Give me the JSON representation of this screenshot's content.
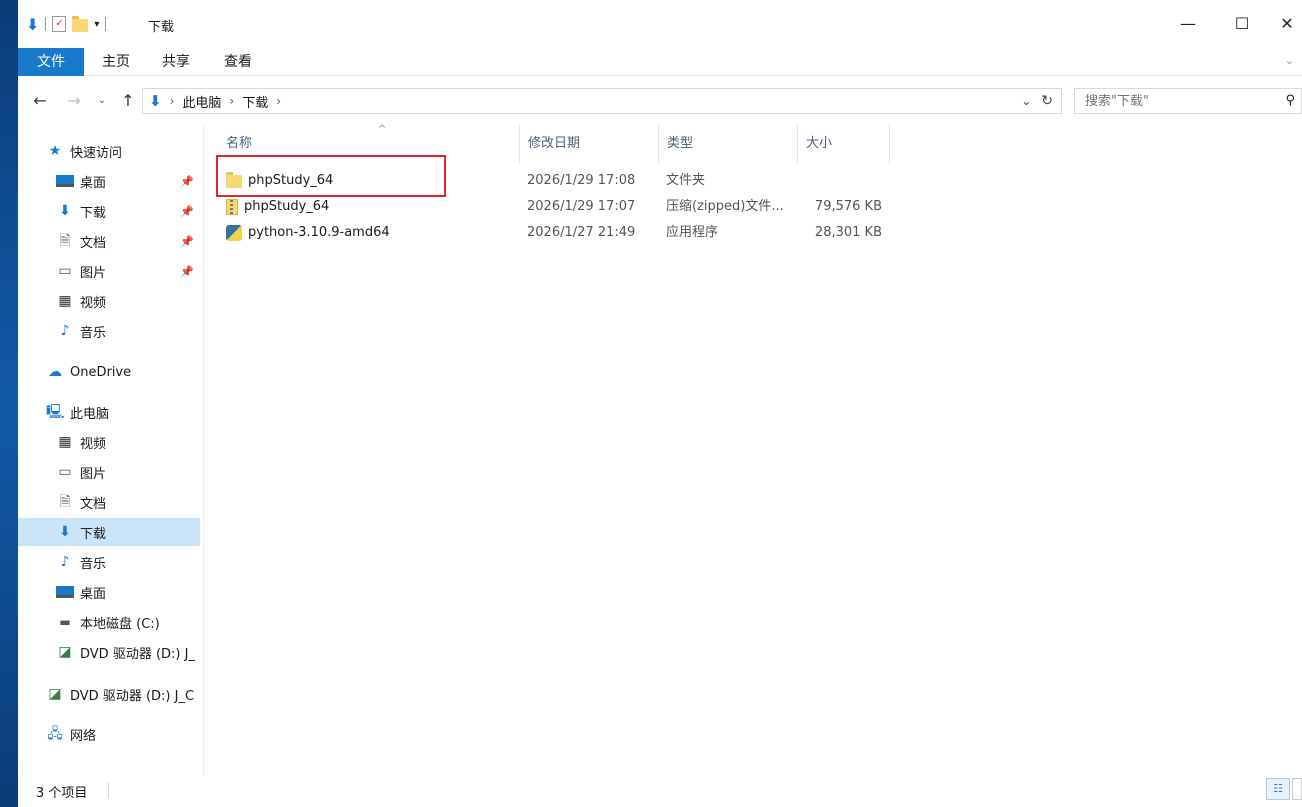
{
  "window": {
    "title": "下载",
    "minimize_icon": "minimize-icon",
    "maximize_icon": "maximize-icon",
    "close_icon": "close-icon"
  },
  "ribbon": {
    "tabs": [
      "文件",
      "主页",
      "共享",
      "查看"
    ]
  },
  "address": {
    "crumbs": [
      "此电脑",
      "下载"
    ],
    "search_placeholder": "搜索\"下载\""
  },
  "navpane": {
    "quick_access": "快速访问",
    "quick_items": [
      "桌面",
      "下载",
      "文档",
      "图片",
      "视频",
      "音乐"
    ],
    "onedrive": "OneDrive",
    "this_pc": "此电脑",
    "pc_items": [
      "视频",
      "图片",
      "文档",
      "下载",
      "音乐",
      "桌面",
      "本地磁盘 (C:)",
      "DVD 驱动器 (D:) J_"
    ],
    "dvd": "DVD 驱动器 (D:) J_C",
    "network": "网络"
  },
  "filelist": {
    "columns": [
      "名称",
      "修改日期",
      "类型",
      "大小"
    ],
    "rows": [
      {
        "name": "phpStudy_64",
        "date": "2026/1/29 17:08",
        "type": "文件夹",
        "size": "",
        "icon": "folder-icon"
      },
      {
        "name": "phpStudy_64",
        "date": "2026/1/29 17:07",
        "type": "压缩(zipped)文件...",
        "size": "79,576 KB",
        "icon": "zip-icon"
      },
      {
        "name": "python-3.10.9-amd64",
        "date": "2026/1/27 21:49",
        "type": "应用程序",
        "size": "28,301 KB",
        "icon": "python-installer-icon"
      }
    ]
  },
  "status": {
    "count": "3 个项目"
  },
  "colors": {
    "accent": "#1979ca",
    "selection": "#cce4f7",
    "highlight": "#e0262a"
  }
}
